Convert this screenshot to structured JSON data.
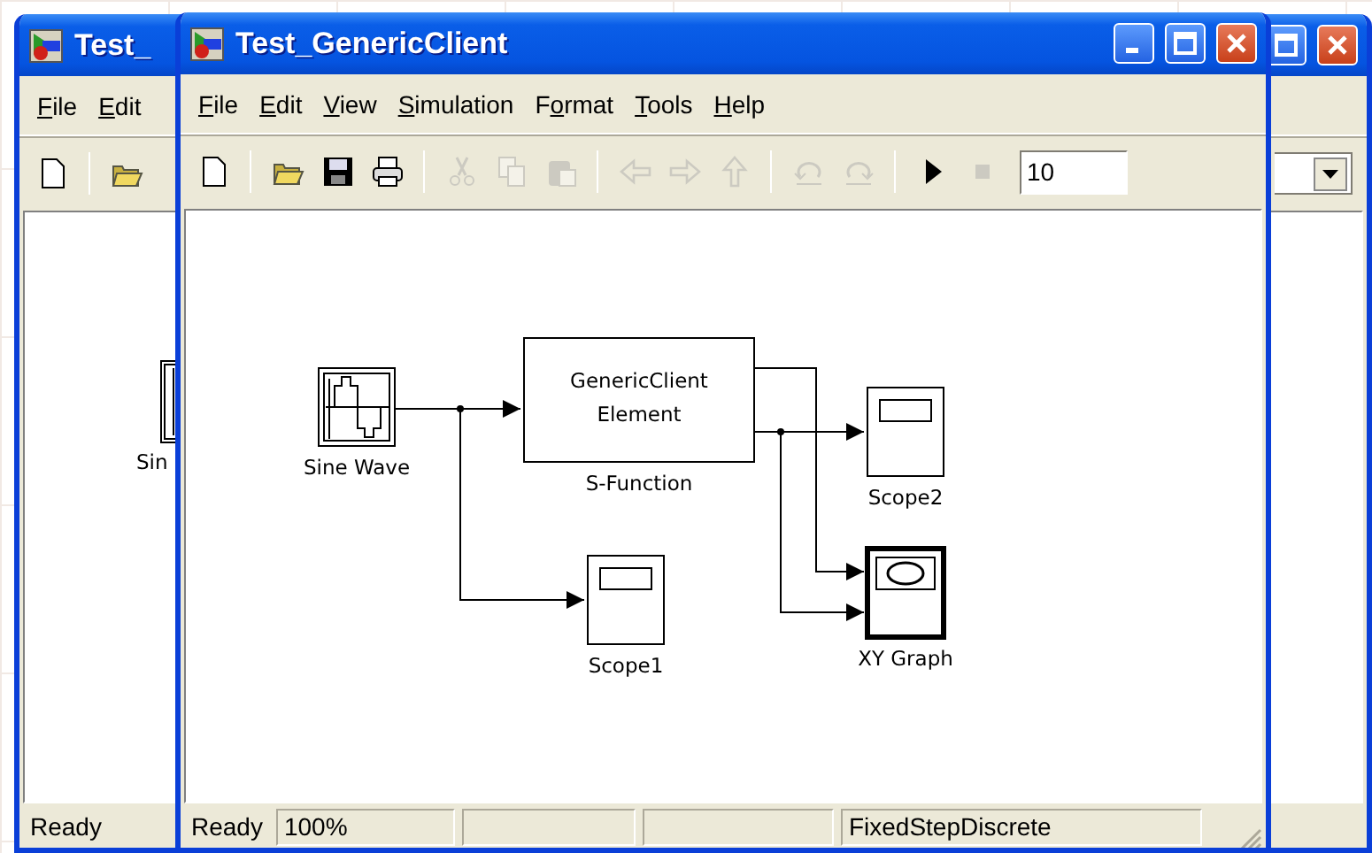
{
  "back_window": {
    "title": "Test_",
    "menu": [
      {
        "key": "F",
        "post": "ile"
      },
      {
        "key": "E",
        "post": "dit"
      }
    ],
    "toolbar": [
      {
        "kind": "new",
        "disabled": false
      },
      {
        "kind": "separator"
      },
      {
        "kind": "open",
        "disabled": false
      }
    ],
    "canvas_label": "Sin",
    "status": "Ready"
  },
  "window": {
    "title": "Test_GenericClient"
  },
  "menu": [
    {
      "key": "F",
      "post": "ile"
    },
    {
      "key": "E",
      "post": "dit"
    },
    {
      "key": "V",
      "post": "iew"
    },
    {
      "key": "S",
      "post": "imulation"
    },
    {
      "pre": "F",
      "key": "o",
      "post": "rmat"
    },
    {
      "key": "T",
      "post": "ools"
    },
    {
      "key": "H",
      "post": "elp"
    }
  ],
  "toolbar": [
    {
      "kind": "new",
      "disabled": false
    },
    {
      "kind": "separator"
    },
    {
      "kind": "open",
      "disabled": false
    },
    {
      "kind": "save",
      "disabled": false
    },
    {
      "kind": "print",
      "disabled": false
    },
    {
      "kind": "separator"
    },
    {
      "kind": "cut",
      "disabled": true
    },
    {
      "kind": "copy",
      "disabled": true
    },
    {
      "kind": "paste",
      "disabled": true
    },
    {
      "kind": "separator"
    },
    {
      "kind": "back",
      "disabled": true
    },
    {
      "kind": "forward",
      "disabled": true
    },
    {
      "kind": "up",
      "disabled": true
    },
    {
      "kind": "separator"
    },
    {
      "kind": "undo",
      "disabled": true
    },
    {
      "kind": "redo",
      "disabled": true
    },
    {
      "kind": "separator"
    },
    {
      "kind": "start",
      "disabled": false
    },
    {
      "kind": "stop",
      "disabled": true
    }
  ],
  "stop_time": "10",
  "diagram": {
    "blocks": [
      {
        "kind": "sine",
        "label": "Sine Wave"
      },
      {
        "kind": "sfunction",
        "label": "S-Function",
        "text": [
          "GenericClient",
          "Element"
        ]
      },
      {
        "kind": "scope",
        "label": "Scope2"
      },
      {
        "kind": "scope",
        "label": "Scope1"
      },
      {
        "kind": "xygraph",
        "label": "XY Graph"
      }
    ]
  },
  "status_bar": [
    {
      "kind": "plain",
      "text": "Ready"
    },
    {
      "kind": "pane",
      "text": "100%"
    },
    {
      "kind": "pane"
    },
    {
      "kind": "pane"
    },
    {
      "kind": "pane",
      "text": "FixedStepDiscrete"
    }
  ]
}
